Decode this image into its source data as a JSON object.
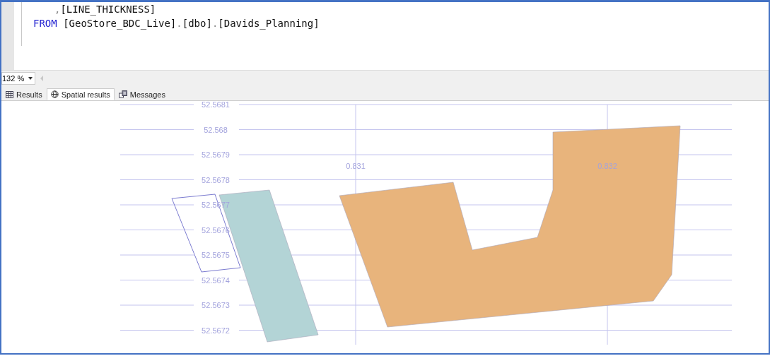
{
  "editor": {
    "lines": [
      {
        "tokens": [
          {
            "kind": "punct",
            "text": ","
          },
          {
            "kind": "ident",
            "text": "[LINE_THICKNESS]"
          }
        ]
      },
      {
        "tokens": [
          {
            "kind": "keyword",
            "text": "FROM"
          },
          {
            "kind": "ident",
            "text": " [GeoStore_BDC_Live]"
          },
          {
            "kind": "punct",
            "text": "."
          },
          {
            "kind": "ident",
            "text": "[dbo]"
          },
          {
            "kind": "punct",
            "text": "."
          },
          {
            "kind": "ident",
            "text": "[Davids_Planning]"
          }
        ]
      }
    ]
  },
  "zoom": {
    "value": "132 %"
  },
  "tabs": [
    {
      "label": "Results",
      "selected": false
    },
    {
      "label": "Spatial results",
      "selected": true
    },
    {
      "label": "Messages",
      "selected": false
    }
  ],
  "spatial_view": {
    "y_labels": [
      "52.5681",
      "52.568",
      "52.5679",
      "52.5678",
      "52.5677",
      "52.5676",
      "52.5675",
      "52.5674",
      "52.5673",
      "52.5672"
    ],
    "x_labels": [
      "0.831",
      "0.832"
    ],
    "shapes": [
      {
        "kind": "outline",
        "color": "#7b7bd0"
      },
      {
        "kind": "filled",
        "color": "#b3d4d6"
      },
      {
        "kind": "filled",
        "color": "#e8b47c"
      }
    ]
  }
}
